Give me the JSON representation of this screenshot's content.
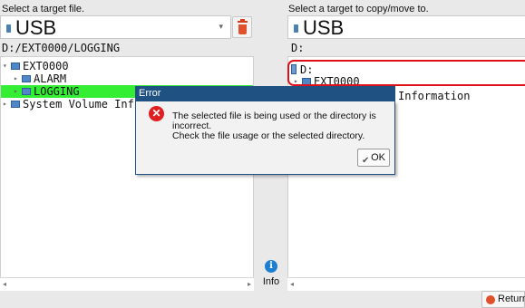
{
  "left_pane": {
    "label": "Select a target file.",
    "device": "USB",
    "path": "D:/EXT0000/LOGGING",
    "tree": [
      {
        "label": "EXT0000",
        "depth": 0,
        "expanded": true,
        "selected": false
      },
      {
        "label": "ALARM",
        "depth": 1,
        "expanded": false,
        "selected": false
      },
      {
        "label": "LOGGING",
        "depth": 1,
        "expanded": false,
        "selected": true
      },
      {
        "label": "System Volume Inf",
        "depth": 0,
        "expanded": false,
        "selected": false
      }
    ]
  },
  "right_pane": {
    "label": "Select a target to copy/move to.",
    "device": "USB",
    "path": "D:",
    "tree": [
      {
        "label": "D:",
        "type": "drive"
      },
      {
        "label": "EXT0000",
        "type": "folder"
      },
      {
        "label": "Information",
        "type": "text"
      }
    ]
  },
  "info_button": {
    "label": "Info"
  },
  "return_button": {
    "label": "Return"
  },
  "dialog": {
    "title": "Error",
    "lines": [
      "The selected file is being used or the directory is",
      "incorrect.",
      "Check the file usage or the selected directory."
    ],
    "ok_label": "OK"
  },
  "colors": {
    "selected_row": "#33ee33",
    "dialog_title": "#1f5282",
    "highlight_border": "#e0101a"
  }
}
